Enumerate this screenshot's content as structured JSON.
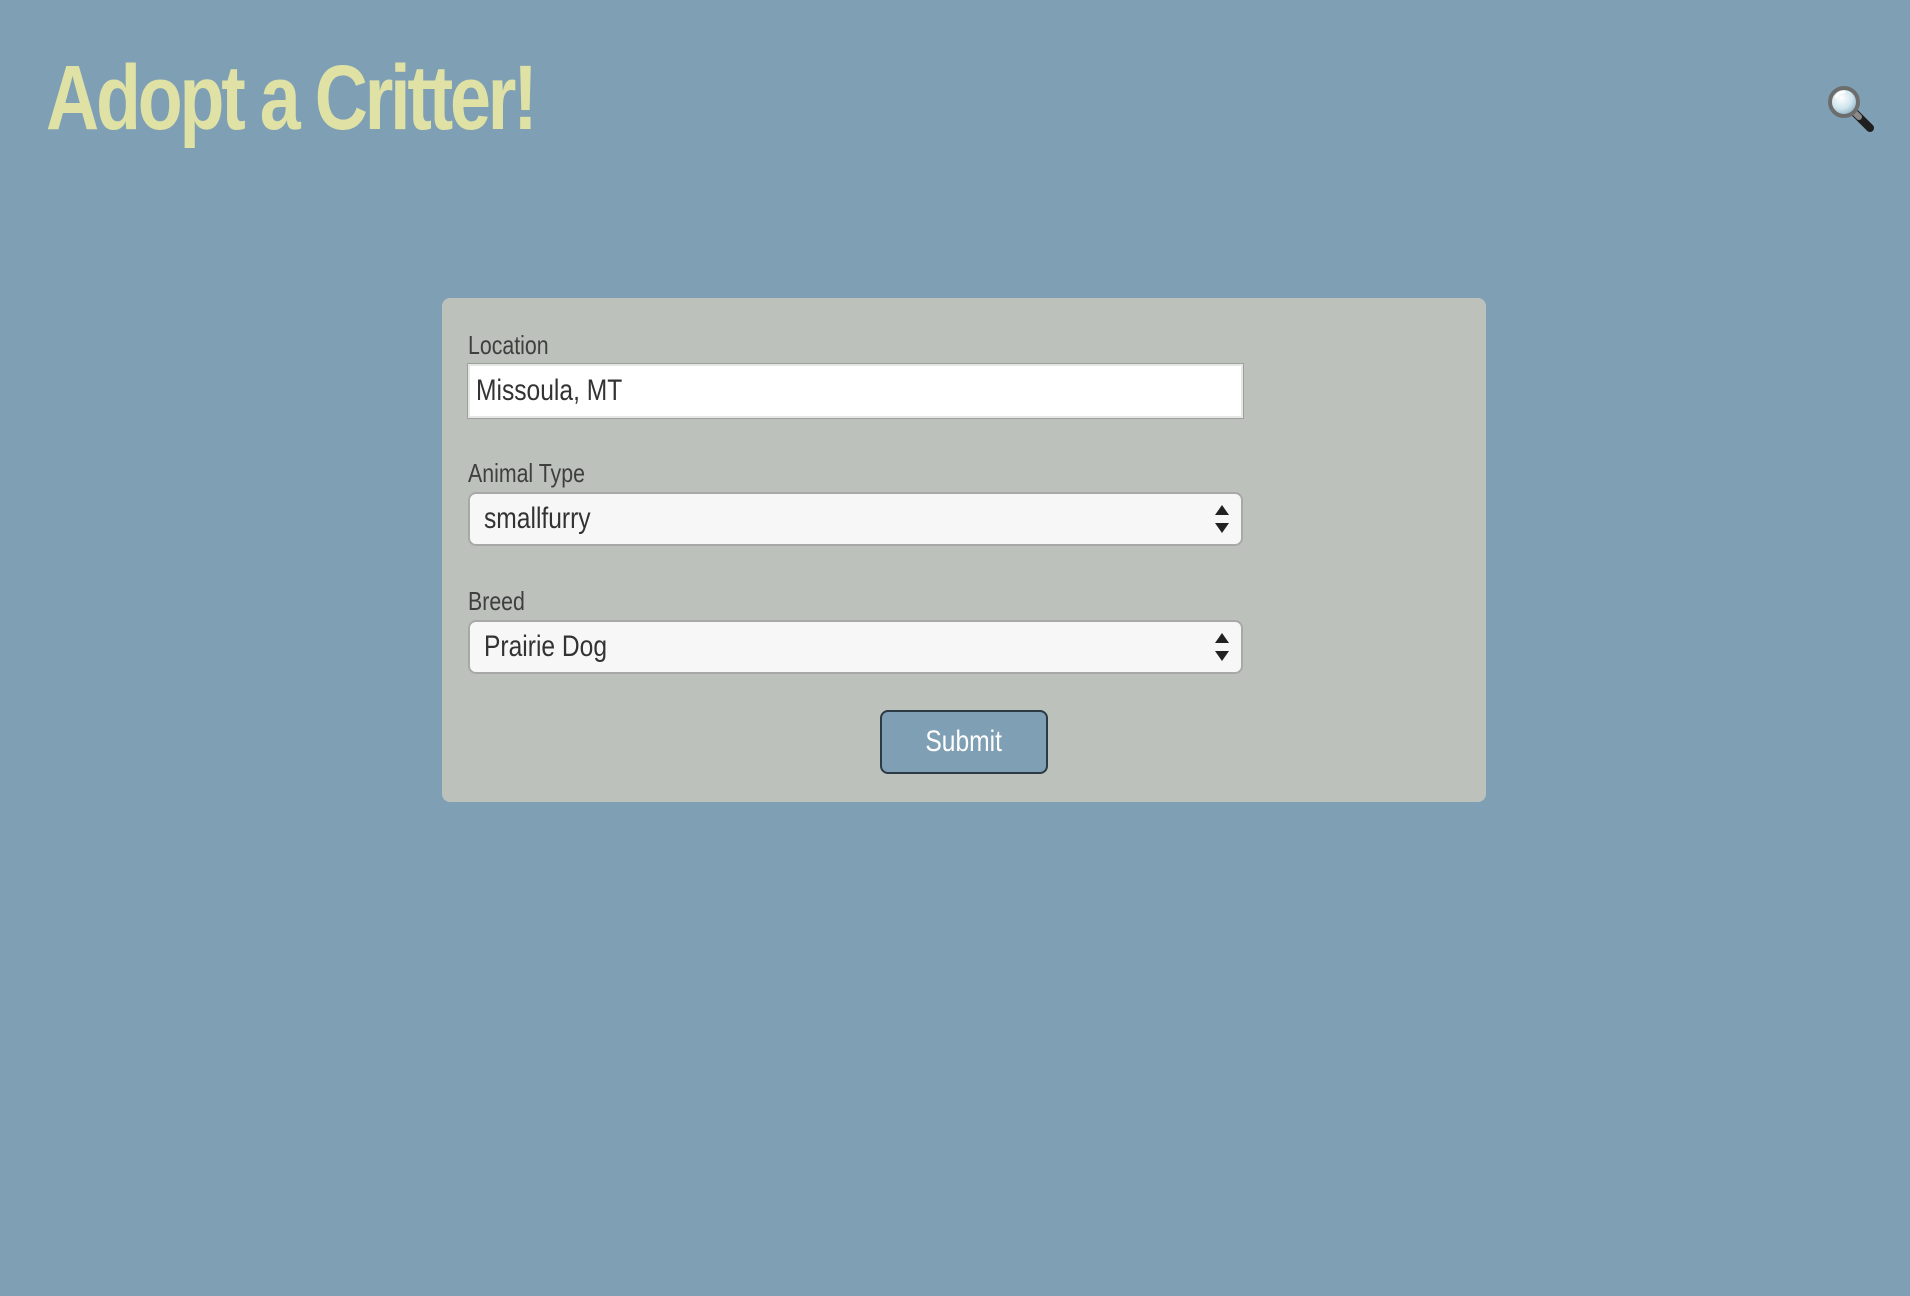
{
  "header": {
    "title": "Adopt a Critter!",
    "search_icon": "search-icon"
  },
  "form": {
    "location": {
      "label": "Location",
      "value": "Missoula, MT"
    },
    "animal_type": {
      "label": "Animal Type",
      "selected": "smallfurry"
    },
    "breed": {
      "label": "Breed",
      "selected": "Prairie Dog"
    },
    "submit_label": "Submit"
  },
  "colors": {
    "page_background": "#7f9fb4",
    "title": "#dfe2a4",
    "card_background": "#bcc2bb",
    "button_background": "#7f9fb4"
  }
}
